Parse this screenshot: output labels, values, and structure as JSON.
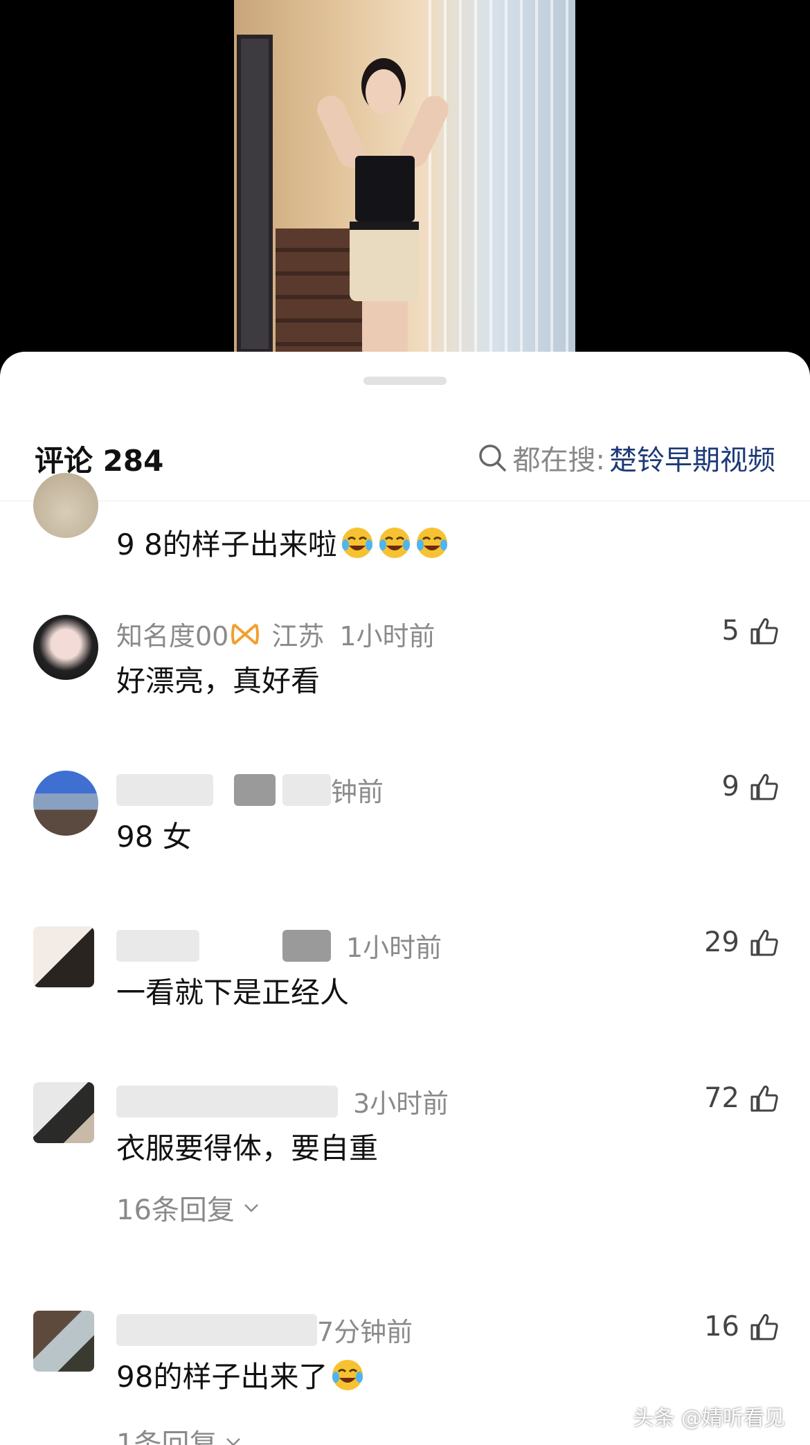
{
  "header": {
    "title": "评论 284",
    "search_prefix": "都在搜:",
    "search_keyword": "楚铃早期视频"
  },
  "comments": [
    {
      "text": "9 8的样子出来啦",
      "emoji_count": 3
    },
    {
      "user": "知名度00",
      "location": "江苏",
      "time": "1小时前",
      "likes": "5",
      "text": "好漂亮，真好看"
    },
    {
      "time": "钟前",
      "likes": "9",
      "text": "98 女"
    },
    {
      "time": "1小时前",
      "likes": "29",
      "text": "一看就下是正经人"
    },
    {
      "time": "3小时前",
      "likes": "72",
      "text": "衣服要得体，要自重",
      "replies": "16条回复"
    },
    {
      "time": "7分钟前",
      "likes": "16",
      "text": "98的样子出来了",
      "emoji_count": 1,
      "replies": "1条回复"
    }
  ],
  "watermark": "头条 @婧听看见",
  "colors": {
    "keyword": "#1d3a78",
    "meta": "#8a8a8a",
    "badge": "#f0a030"
  }
}
